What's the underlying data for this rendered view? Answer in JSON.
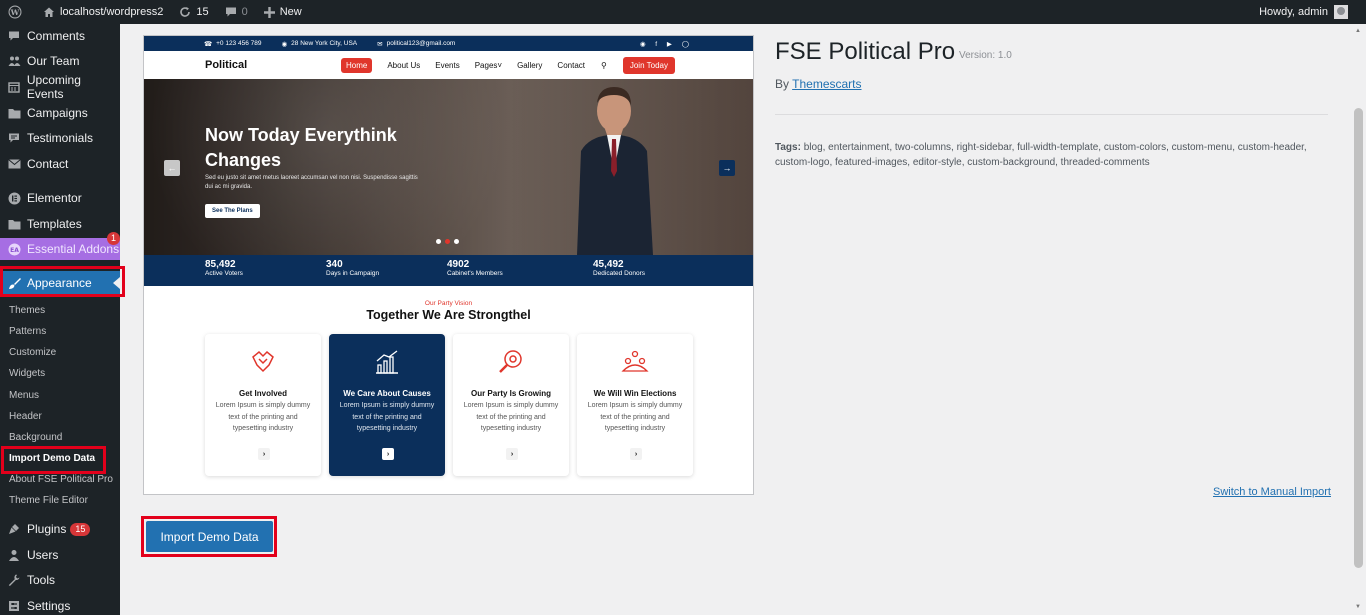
{
  "adminbar": {
    "site": "localhost/wordpress2",
    "updates_count": "15",
    "comments_count": "0",
    "new_label": "New",
    "greeting": "Howdy, admin"
  },
  "sidebar": {
    "items": [
      {
        "label": "Comments",
        "icon": "comment-icon"
      },
      {
        "label": "Our Team",
        "icon": "team-icon"
      },
      {
        "label": "Upcoming Events",
        "icon": "calendar-icon"
      },
      {
        "label": "Campaigns",
        "icon": "folder-icon"
      },
      {
        "label": "Testimonials",
        "icon": "quote-icon"
      },
      {
        "label": "Contact",
        "icon": "mail-icon"
      },
      {
        "label": "Elementor",
        "icon": "elementor-icon"
      },
      {
        "label": "Templates",
        "icon": "folder-icon"
      },
      {
        "label": "Essential Addons",
        "icon": "ea-icon",
        "badge": "1"
      },
      {
        "label": "Appearance",
        "icon": "brush-icon"
      },
      {
        "label": "Plugins",
        "icon": "plug-icon",
        "badge": "15"
      },
      {
        "label": "Users",
        "icon": "user-icon"
      },
      {
        "label": "Tools",
        "icon": "wrench-icon"
      },
      {
        "label": "Settings",
        "icon": "settings-icon"
      }
    ],
    "submenu": [
      "Themes",
      "Patterns",
      "Customize",
      "Widgets",
      "Menus",
      "Header",
      "Background",
      "Import Demo Data",
      "About FSE Political Pro",
      "Theme File Editor"
    ]
  },
  "preview": {
    "topbar": {
      "phone": "+0 123 456 789",
      "address": "28 New York City, USA",
      "email": "political123@gmail.com"
    },
    "logo": "Political",
    "nav": [
      "Home",
      "About Us",
      "Events",
      "Pages",
      "Gallery",
      "Contact"
    ],
    "join": "Join Today",
    "hero": {
      "title": "Now Today Everythink Changes",
      "text": "Sed eu justo sit amet metus laoreet accumsan vel non nisi. Suspendisse sagittis dui ac mi gravida.",
      "button": "See The Plans"
    },
    "stats": [
      {
        "num": "85,492",
        "label": "Active Voters"
      },
      {
        "num": "340",
        "label": "Days in Campaign"
      },
      {
        "num": "4902",
        "label": "Cabinet's Members"
      },
      {
        "num": "45,492",
        "label": "Dedicated Donors"
      }
    ],
    "vision_small": "Our Party Vision",
    "vision_title": "Together We Are Strongthel",
    "cards": [
      {
        "title": "Get Involved",
        "desc": "Lorem Ipsum is simply dummy text of the printing and typesetting industry"
      },
      {
        "title": "We Care About Causes",
        "desc": "Lorem Ipsum is simply dummy text of the printing and typesetting industry"
      },
      {
        "title": "Our Party Is Growing",
        "desc": "Lorem Ipsum is simply dummy text of the printing and typesetting industry"
      },
      {
        "title": "We Will Win Elections",
        "desc": "Lorem Ipsum is simply dummy text of the printing and typesetting industry"
      }
    ]
  },
  "theme": {
    "name": "FSE Political Pro",
    "version": "Version: 1.0",
    "by_prefix": "By",
    "author": "Themescarts",
    "tags_label": "Tags:",
    "tags": "blog, entertainment, two-columns, right-sidebar, full-width-template, custom-colors, custom-menu, custom-header, custom-logo, featured-images, editor-style, custom-background, threaded-comments"
  },
  "manual_import": "Switch to Manual Import",
  "import_button": "Import Demo Data",
  "colors": {
    "wp_dark": "#1d2327",
    "wp_blue": "#2271b1",
    "highlight_red": "#e3001b",
    "theme_navy": "#0b2f5b",
    "theme_red": "#e0362c"
  }
}
